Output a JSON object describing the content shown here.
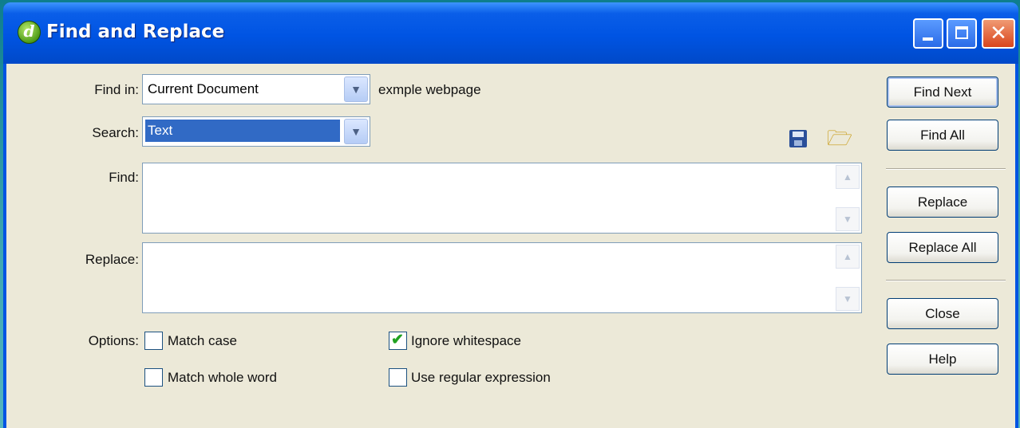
{
  "window": {
    "title": "Find and Replace",
    "icons": {
      "app": "dreamweaver-app-icon",
      "minimize": "minimize-icon",
      "maximize": "maximize-icon",
      "close": "close-icon"
    }
  },
  "form": {
    "find_in_label": "Find in:",
    "find_in_value": "Current Document",
    "find_in_context": "exmple webpage",
    "search_label": "Search:",
    "search_value": "Text",
    "find_label": "Find:",
    "find_value": "",
    "replace_label": "Replace:",
    "replace_value": "",
    "options_label": "Options:"
  },
  "options": {
    "match_case": {
      "label": "Match case",
      "checked": false
    },
    "ignore_whitespace": {
      "label": "Ignore whitespace",
      "checked": true
    },
    "match_whole_word": {
      "label": "Match whole word",
      "checked": false
    },
    "use_regex": {
      "label": "Use regular expression",
      "checked": false
    }
  },
  "buttons": {
    "find_next": "Find Next",
    "find_all": "Find All",
    "replace": "Replace",
    "replace_all": "Replace All",
    "close": "Close",
    "help": "Help"
  },
  "toolbar_icons": {
    "save": "save-query-icon",
    "open": "load-query-icon"
  },
  "colors": {
    "titlebar": "#0054e3",
    "dialog_bg": "#ece9d8",
    "selection": "#316ac5",
    "check": "#21a121"
  }
}
